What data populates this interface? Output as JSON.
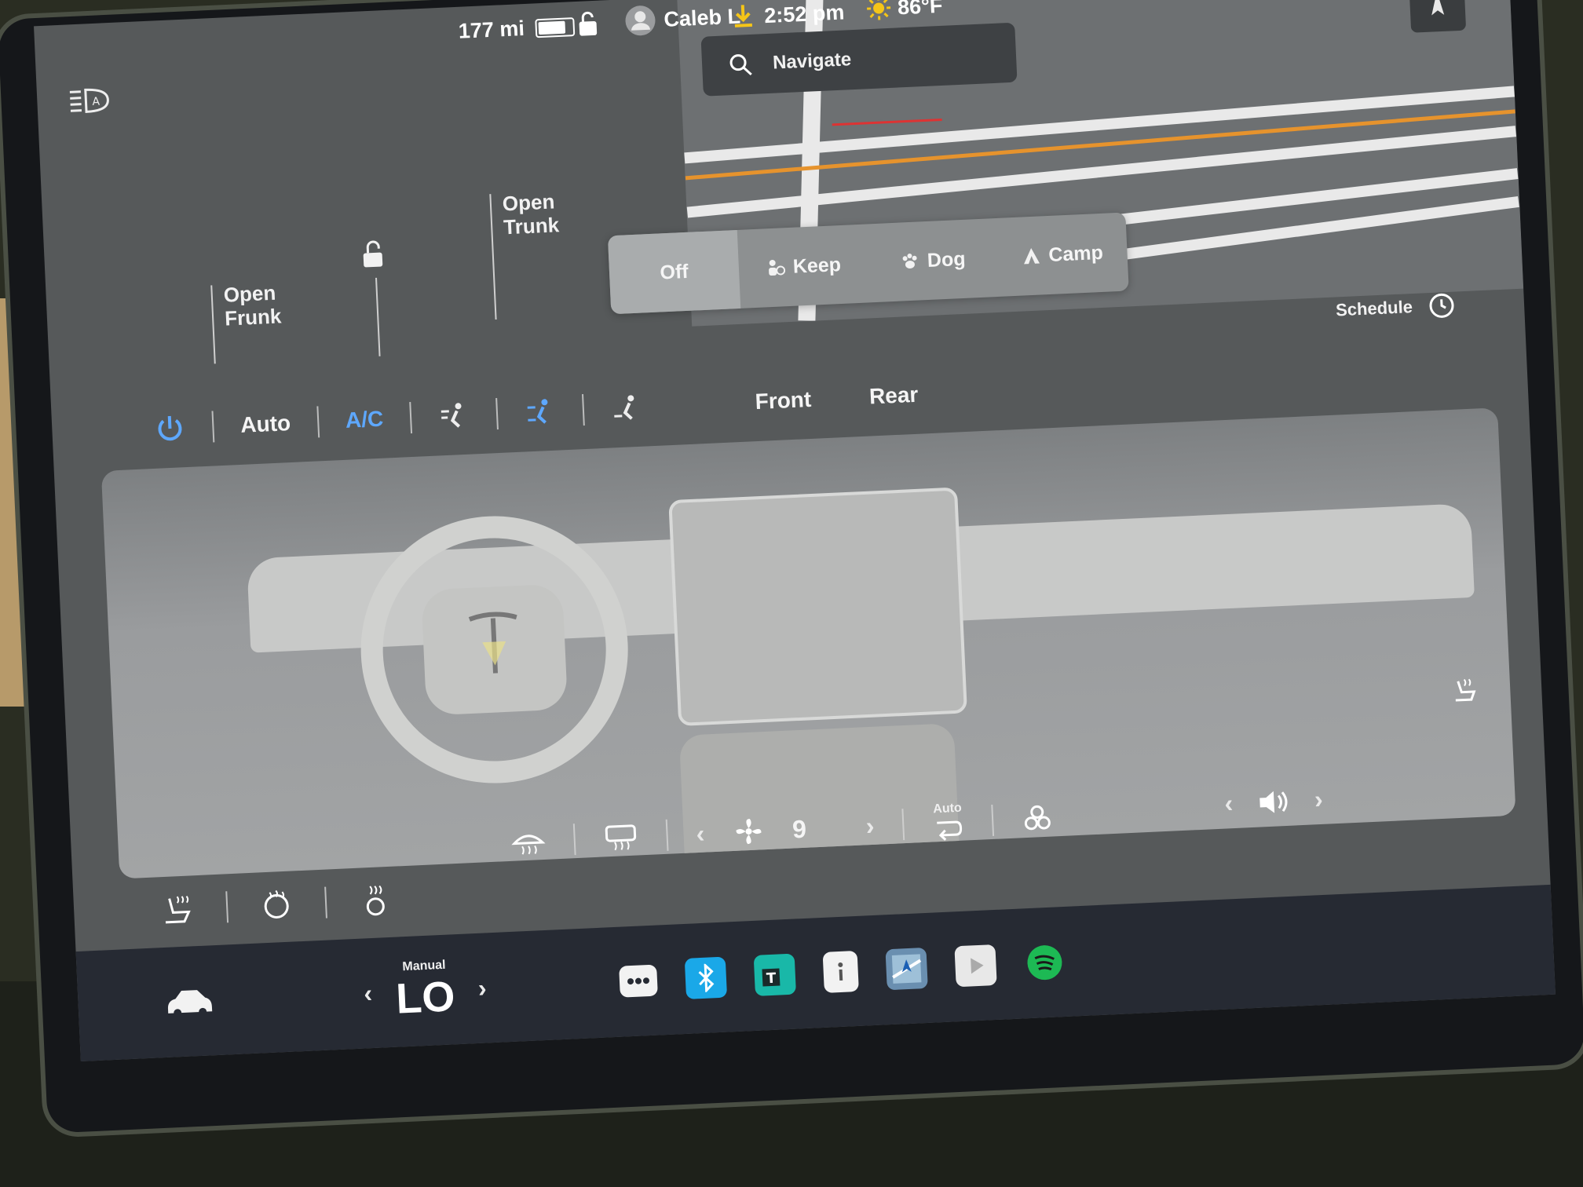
{
  "status_bar": {
    "range": "177 mi",
    "user": "Caleb L",
    "time": "2:52 pm",
    "temperature": "86°F",
    "battery_level": 0.85
  },
  "map": {
    "search_placeholder": "Navigate"
  },
  "vehicle": {
    "open_frunk": [
      "Open",
      "Frunk"
    ],
    "open_trunk": [
      "Open",
      "Trunk"
    ]
  },
  "climate_keeper": {
    "modes": [
      {
        "label": "Off",
        "icon": "none",
        "active": true
      },
      {
        "label": "Keep",
        "icon": "fan-person-icon",
        "active": false
      },
      {
        "label": "Dog",
        "icon": "paw-icon",
        "active": false
      },
      {
        "label": "Camp",
        "icon": "tent-icon",
        "active": false
      }
    ]
  },
  "climate": {
    "auto_label": "Auto",
    "ac_label": "A/C",
    "front_label": "Front",
    "rear_label": "Rear",
    "schedule_label": "Schedule",
    "fan_speed": "9",
    "recirc_label": "Auto",
    "manual_label": "Manual",
    "temp_setting": "LO"
  },
  "colors": {
    "accent_blue": "#5ea8ff",
    "screen_bg": "#56595a",
    "dock_bg": "#262a33",
    "spotify_green": "#1db954",
    "bluetooth_blue": "#1aa8e8"
  }
}
